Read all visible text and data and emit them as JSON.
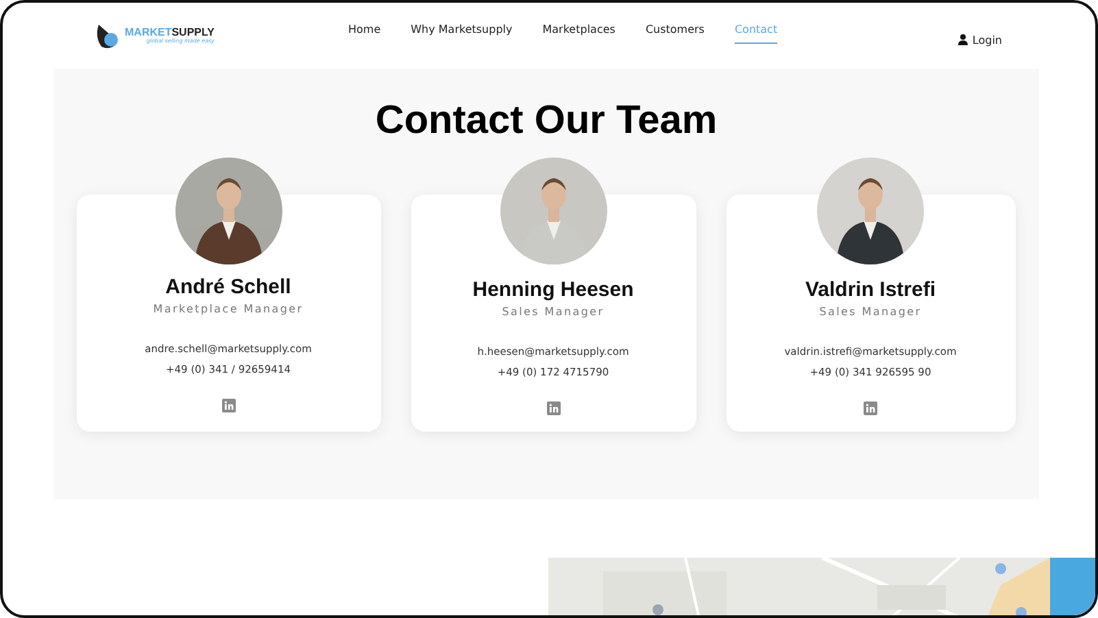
{
  "nav": {
    "logo": {
      "brand_a": "MARKET",
      "brand_b": "SUPPLY",
      "tagline": "global selling made easy"
    },
    "links": [
      {
        "label": "Home",
        "selected": false
      },
      {
        "label": "Why Marketsupply",
        "selected": false
      },
      {
        "label": "Marketplaces",
        "selected": false
      },
      {
        "label": "Customers",
        "selected": false
      },
      {
        "label": "Contact",
        "selected": true
      }
    ],
    "login": "Login"
  },
  "title": "Contact Our Team",
  "team": [
    {
      "name": "André Schell",
      "role": "Marketplace Manager",
      "email": "andre.schell@marketsupply.com",
      "phone": "+49 (0) 341 / 92659414"
    },
    {
      "name": "Henning Heesen",
      "role": "Sales Manager",
      "email": "h.heesen@marketsupply.com",
      "phone": "+49 (0) 172 4715790"
    },
    {
      "name": "Valdrin Istrefi",
      "role": "Sales Manager",
      "email": "valdrin.istrefi@marketsupply.com",
      "phone": "+49 (0) 341 926595 90"
    }
  ]
}
